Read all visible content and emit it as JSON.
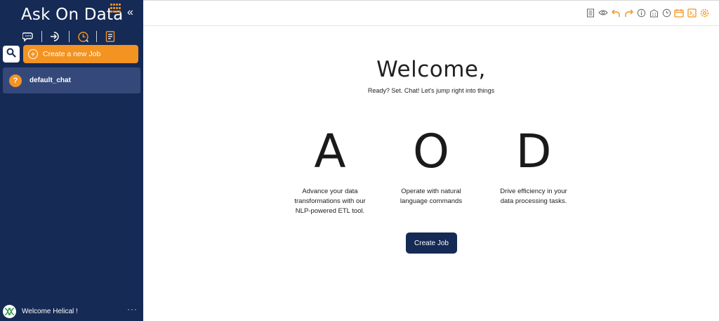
{
  "app": {
    "title": "Ask On Data"
  },
  "sidebar": {
    "create_label": "Create a new Job",
    "chats": [
      {
        "label": "default_chat",
        "badge": "?"
      }
    ],
    "user_label": "Welcome Helical !",
    "more_label": "···",
    "collapse_label": "«"
  },
  "main": {
    "welcome": "Welcome,",
    "tagline": "Ready? Set. Chat! Let's jump right into things",
    "features": [
      {
        "letter": "A",
        "line1": "Advance your data",
        "line2": "transformations with our",
        "line3": "NLP-powered ETL tool."
      },
      {
        "letter": "O",
        "line1": "Operate with natural",
        "line2": "language commands",
        "line3": ""
      },
      {
        "letter": "D",
        "line1": "Drive efficiency in your",
        "line2": "data processing tasks.",
        "line3": ""
      }
    ],
    "cta_label": "Create Job"
  },
  "colors": {
    "sidebar": "#152a55",
    "accent": "#f39322",
    "chat_item": "#34497a"
  },
  "icons": {
    "nav": [
      "chat-icon",
      "login-icon",
      "history-icon",
      "report-icon"
    ],
    "toolbar": [
      "notes-icon",
      "eye-icon",
      "undo-icon",
      "redo-icon",
      "info-icon",
      "building-icon",
      "clock-icon",
      "calendar-icon",
      "terminal-icon",
      "settings-icon"
    ]
  }
}
